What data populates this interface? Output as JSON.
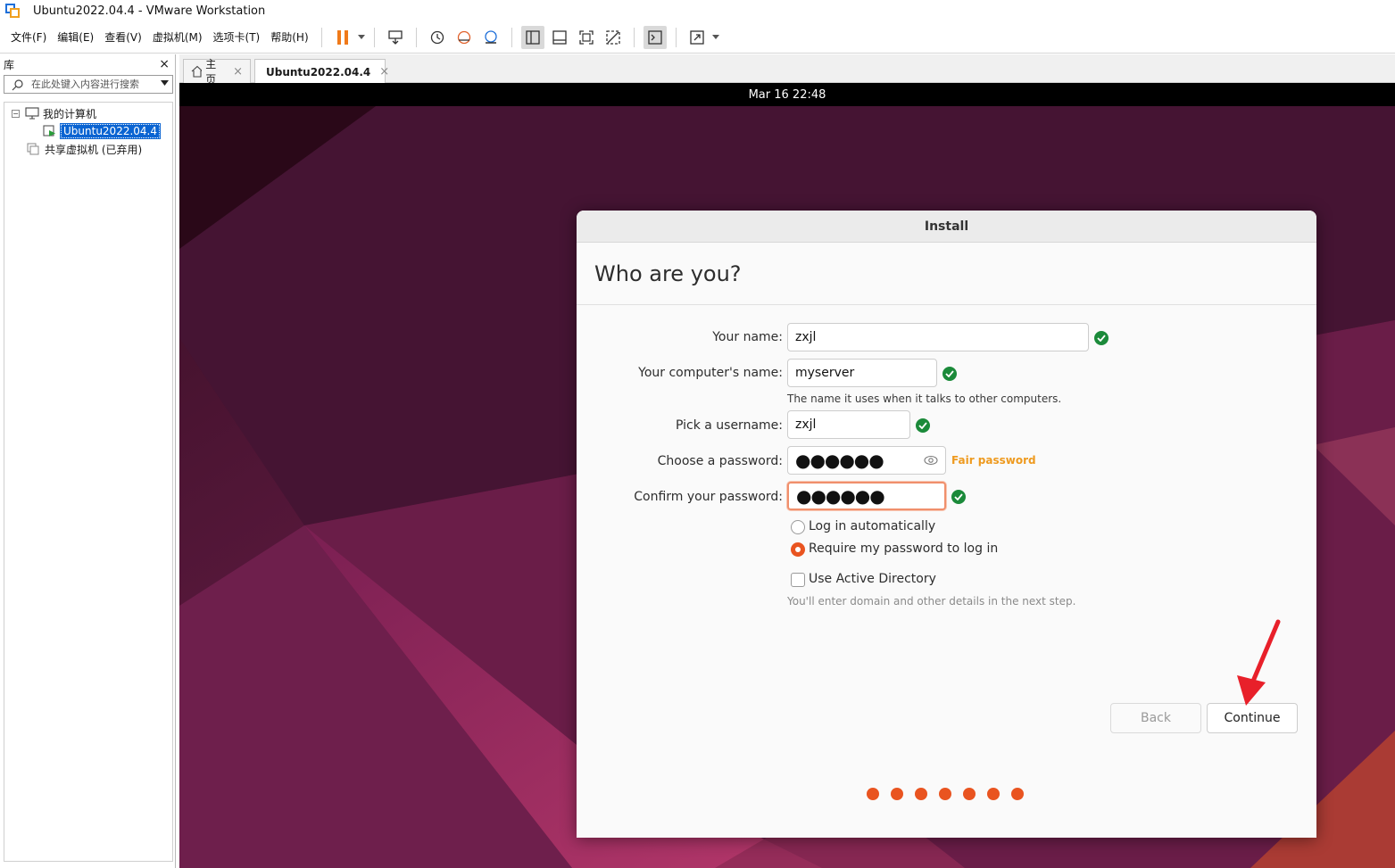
{
  "window": {
    "title": "Ubuntu2022.04.4 - VMware Workstation"
  },
  "menu": {
    "items": [
      "文件(F)",
      "编辑(E)",
      "查看(V)",
      "虚拟机(M)",
      "选项卡(T)",
      "帮助(H)"
    ]
  },
  "toolbar": {
    "icons": [
      "pause-icon",
      "send-ctrl-alt-del-icon",
      "snapshot-icon",
      "revert-snapshot-icon",
      "snapshot-manager-icon",
      "show-library-icon",
      "thumbnail-bar-icon",
      "fullscreen-icon",
      "unity-icon",
      "console-view-icon",
      "stretch-icon"
    ]
  },
  "library": {
    "title": "库",
    "close": "×",
    "search_placeholder": "在此处键入内容进行搜索",
    "tree": {
      "my_computer": "我的计算机",
      "vm": "Ubuntu2022.04.4",
      "shared": "共享虚拟机 (已弃用)"
    }
  },
  "tabs": [
    {
      "label": "主页",
      "close": "×"
    },
    {
      "label": "Ubuntu2022.04.4",
      "close": "×"
    }
  ],
  "vm": {
    "datetime": "Mar 16  22:48"
  },
  "installer": {
    "window_title": "Install",
    "heading": "Who are you?",
    "labels": {
      "name": "Your name:",
      "computer": "Your computer's name:",
      "username": "Pick a username:",
      "password": "Choose a password:",
      "confirm": "Confirm your password:"
    },
    "values": {
      "name": "zxjl",
      "computer": "myserver",
      "username": "zxjl",
      "password": "●●●●●●",
      "confirm": "●●●●●●"
    },
    "computer_hint": "The name it uses when it talks to other computers.",
    "password_strength": "Fair password",
    "login_options": {
      "auto": "Log in automatically",
      "require": "Require my password to log in",
      "selected": "require"
    },
    "active_directory": {
      "label": "Use Active Directory",
      "checked": false,
      "hint": "You'll enter domain and other details in the next step."
    },
    "buttons": {
      "back": "Back",
      "continue": "Continue"
    },
    "progress": {
      "total_steps": 7
    },
    "accent_color": "#e95420",
    "check_color": "#1b8a3a",
    "strength_color": "#ee9a1f"
  },
  "annotation": {
    "arrow_color": "#e8202a"
  }
}
